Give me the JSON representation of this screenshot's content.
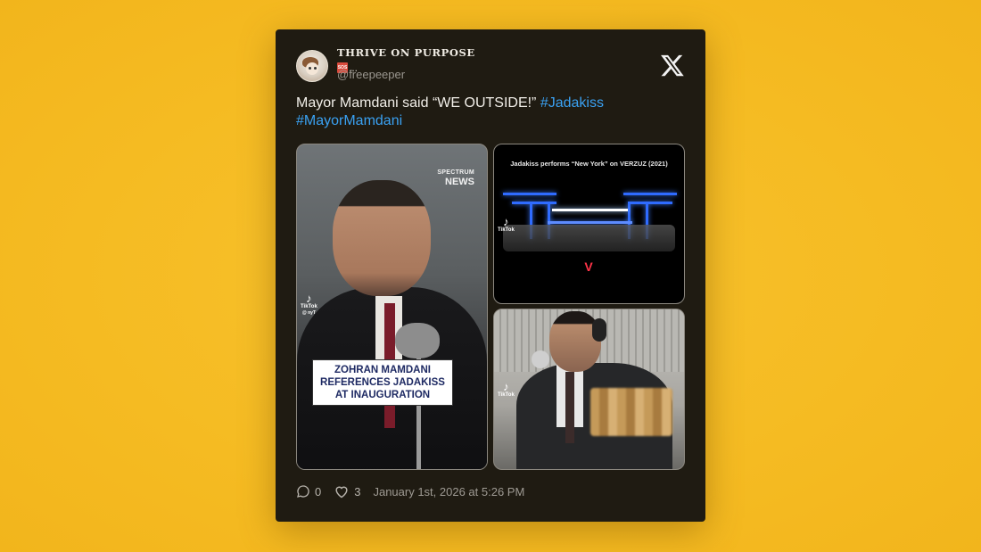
{
  "author": {
    "display_name": "THRIVE ON PURPOSE",
    "badge_label": "SOS",
    "ellipsis": "...",
    "handle": "@freepeeper"
  },
  "tweet": {
    "text": "Mayor Mamdani said “WE OUTSIDE!” ",
    "hashtags": [
      "#Jadakiss",
      "#MayorMamdani"
    ]
  },
  "media": {
    "video1": {
      "network_top": "SPECTRUM",
      "network_bottom": "NEWS",
      "caption": "ZOHRAN MAMDANI REFERENCES JADAKISS AT INAUGURATION",
      "watermark": "TikTok",
      "watermark_user": "@ nyT"
    },
    "video2": {
      "title": "Jadakiss performs “New York” on VERZUZ (2021)",
      "watermark": "TikTok",
      "logo": "V"
    },
    "video3": {
      "watermark": "TikTok"
    }
  },
  "actions": {
    "reply_count": "0",
    "like_count": "3",
    "date": "January 1st, 2026 at 5:26 PM"
  },
  "icons": [
    "x-logo-icon",
    "reply-icon",
    "heart-icon",
    "tiktok-icon"
  ],
  "colors": {
    "background": "#f5bb22",
    "card": "#1f1b12",
    "hashtag": "#3aa1f2"
  }
}
